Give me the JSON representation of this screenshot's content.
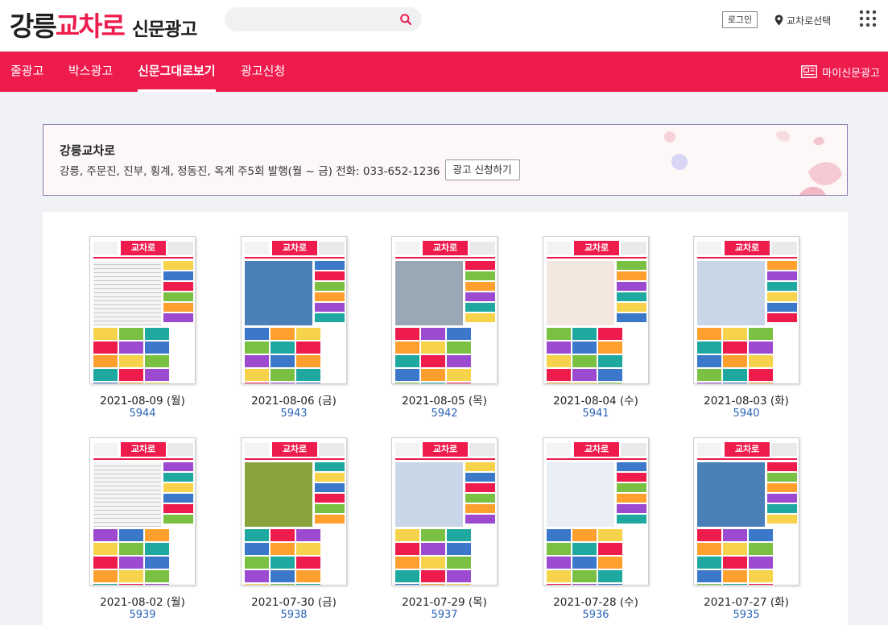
{
  "header": {
    "logo_city": "강릉",
    "logo_brand": "교차로",
    "logo_sub": "신문광고",
    "search_placeholder": "",
    "login_label": "로그인",
    "region_label": "교차로선택"
  },
  "nav": {
    "items": [
      {
        "label": "줄광고"
      },
      {
        "label": "박스광고"
      },
      {
        "label": "신문그대로보기"
      },
      {
        "label": "광고신청"
      }
    ],
    "my_ad_label": "마이신문광고"
  },
  "info": {
    "title": "강릉교차로",
    "description": "강릉, 주문진, 진부, 횡계, 정동진, 옥계 주5회 발행(월 ~ 금) 전화: 033-652-1236",
    "apply_label": "광고 신청하기"
  },
  "issues": [
    {
      "date": "2021-08-09 (월)",
      "number": "5944",
      "brand": "교차로",
      "theme": "text"
    },
    {
      "date": "2021-08-06 (금)",
      "number": "5943",
      "brand": "교차로",
      "theme": "solar"
    },
    {
      "date": "2021-08-05 (목)",
      "number": "5942",
      "brand": "교차로",
      "theme": "building"
    },
    {
      "date": "2021-08-04 (수)",
      "number": "5941",
      "brand": "교차로",
      "theme": "food"
    },
    {
      "date": "2021-08-03 (화)",
      "number": "5940",
      "brand": "교차로",
      "theme": "villa"
    },
    {
      "date": "2021-08-02 (월)",
      "number": "5939",
      "brand": "교차로",
      "theme": "text"
    },
    {
      "date": "2021-07-30 (금)",
      "number": "5938",
      "brand": "교차로",
      "theme": "furniture"
    },
    {
      "date": "2021-07-29 (목)",
      "number": "5937",
      "brand": "교차로",
      "theme": "villa"
    },
    {
      "date": "2021-07-28 (수)",
      "number": "5936",
      "brand": "교차로",
      "theme": "people"
    },
    {
      "date": "2021-07-27 (화)",
      "number": "5935",
      "brand": "교차로",
      "theme": "solar"
    }
  ],
  "colors": {
    "brand": "#ee1b4d",
    "link": "#2c64b6",
    "theme_main": {
      "text": "#f4f4f4",
      "solar": "#4a7fb8",
      "building": "#9aa7b5",
      "food": "#f3e7df",
      "villa": "#c8d6e8",
      "furniture": "#8aa23c",
      "people": "#e9eef5"
    }
  },
  "icons": [
    "search-icon",
    "pin-icon",
    "apps-grid-icon",
    "newspaper-icon"
  ]
}
